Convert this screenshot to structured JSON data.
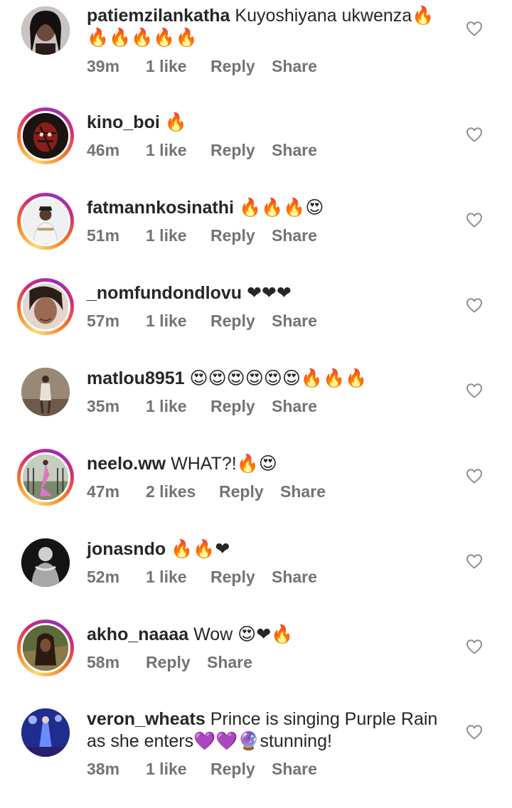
{
  "actions": {
    "reply": "Reply",
    "share": "Share"
  },
  "comments": [
    {
      "username": "patiemzilankatha",
      "text": "Kuyoshiyana ukwenza🔥🔥🔥🔥🔥🔥",
      "time": "39m",
      "likes": "1 like"
    },
    {
      "username": "kino_boi",
      "text": "🔥",
      "time": "46m",
      "likes": "1 like"
    },
    {
      "username": "fatmannkosinathi",
      "text": "🔥🔥🔥😍",
      "time": "51m",
      "likes": "1 like"
    },
    {
      "username": "_nomfundondlovu",
      "text": "❤❤❤",
      "time": "57m",
      "likes": "1 like"
    },
    {
      "username": "matlou8951",
      "text": "😍😍😍😍😍😍🔥🔥🔥",
      "time": "35m",
      "likes": "1 like"
    },
    {
      "username": "neelo.ww",
      "text": "WHAT?!🔥😍",
      "time": "47m",
      "likes": "2 likes"
    },
    {
      "username": "jonasndo",
      "text": "🔥🔥❤",
      "time": "52m",
      "likes": "1 like"
    },
    {
      "username": "akho_naaaa",
      "text": "Wow 😍❤🔥",
      "time": "58m",
      "likes": ""
    },
    {
      "username": "veron_wheats",
      "text": "Prince is singing Purple Rain as she enters💜💜🔮stunning!",
      "time": "38m",
      "likes": "1 like"
    }
  ]
}
